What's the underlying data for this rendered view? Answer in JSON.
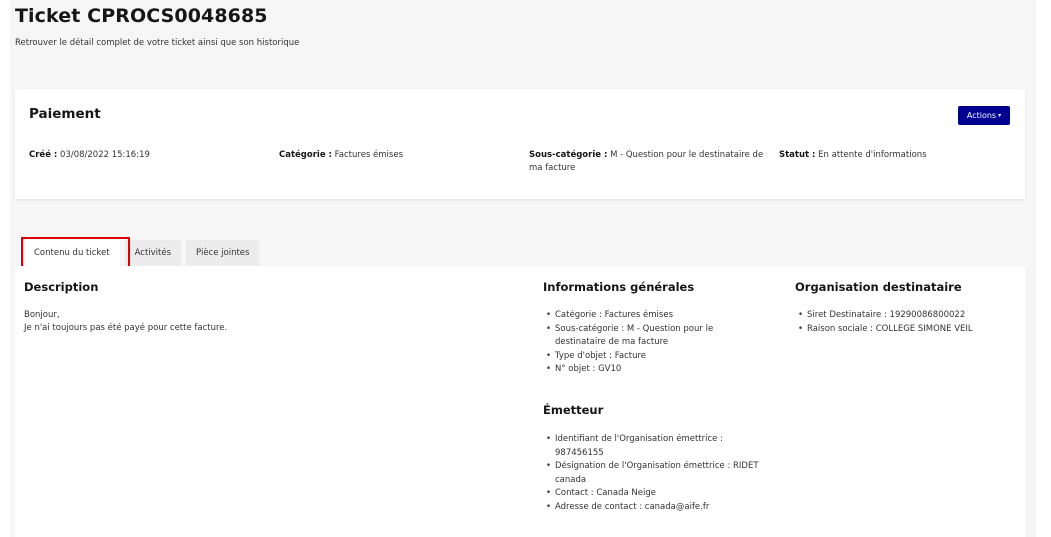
{
  "header": {
    "title": "Ticket CPROCS0048685",
    "subtitle": "Retrouver le détail complet de votre ticket ainsi que son historique"
  },
  "summary": {
    "title": "Paiement",
    "actions_label": "Actions",
    "created_label": "Créé :",
    "created_value": "03/08/2022 15:16:19",
    "category_label": "Catégorie :",
    "category_value": "Factures émises",
    "subcategory_label": "Sous-catégorie :",
    "subcategory_value": "M - Question pour le destinataire de ma facture",
    "status_label": "Statut :",
    "status_value": "En attente d'informations"
  },
  "tabs": [
    {
      "label": "Contenu du ticket",
      "active": true
    },
    {
      "label": "Activités",
      "active": false
    },
    {
      "label": "Pièce jointes",
      "active": false
    }
  ],
  "description": {
    "heading": "Description",
    "lines": [
      "Bonjour,",
      "Je n'ai toujours pas été payé pour cette facture."
    ]
  },
  "general_info": {
    "heading": "Informations générales",
    "items": [
      "Catégorie : Factures émises",
      "Sous-catégorie : M - Question pour le destinataire de ma facture",
      "Type d'objet : Facture",
      "N° objet : GV10"
    ]
  },
  "recipient_org": {
    "heading": "Organisation destinataire",
    "items": [
      "Siret Destinataire : 19290086800022",
      "Raison sociale : COLLEGE SIMONE VEIL"
    ]
  },
  "issuer": {
    "heading": "Émetteur",
    "items": [
      "Identifiant de l'Organisation émettrice : 987456155",
      "Désignation de l'Organisation émettrice : RIDET canada",
      "Contact : Canada Neige",
      "Adresse de contact : canada@aife.fr"
    ]
  },
  "colors": {
    "primary": "#000091",
    "highlight": "#e00000",
    "page_background": "#f6f6f6"
  }
}
